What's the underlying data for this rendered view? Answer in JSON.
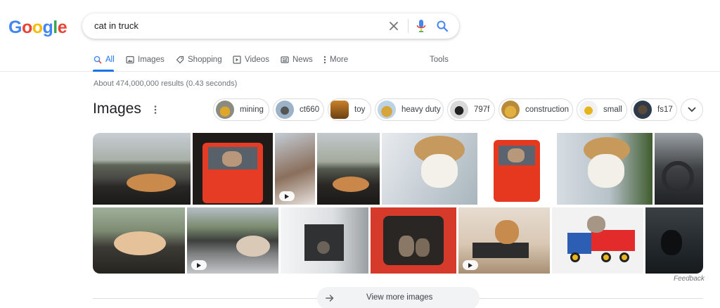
{
  "logo": {
    "text": "Google",
    "colors": [
      "#4285F4",
      "#EA4335",
      "#FBBC05",
      "#4285F4",
      "#34A853",
      "#EA4335"
    ]
  },
  "search": {
    "query": "cat in truck",
    "icons": [
      "clear-icon",
      "mic-icon",
      "search-icon"
    ]
  },
  "tabs": [
    {
      "label": "All",
      "icon": "search-icon",
      "active": true
    },
    {
      "label": "Images",
      "icon": "image-icon"
    },
    {
      "label": "Shopping",
      "icon": "tag-icon"
    },
    {
      "label": "Videos",
      "icon": "play-icon"
    },
    {
      "label": "News",
      "icon": "newspaper-icon"
    },
    {
      "label": "More",
      "icon": "vertical-dots-icon"
    },
    {
      "label": "Tools"
    }
  ],
  "stats": "About 474,000,000 results (0.43 seconds)",
  "images_section": {
    "title": "Images",
    "chips": [
      "mining",
      "ct660",
      "toy",
      "heavy duty",
      "797f",
      "construction",
      "small",
      "fs17"
    ],
    "feedback": "Feedback",
    "view_more": "View more images"
  },
  "colors": {
    "accent": "#1a73e8",
    "muted": "#70757a",
    "border": "#dadce0"
  }
}
